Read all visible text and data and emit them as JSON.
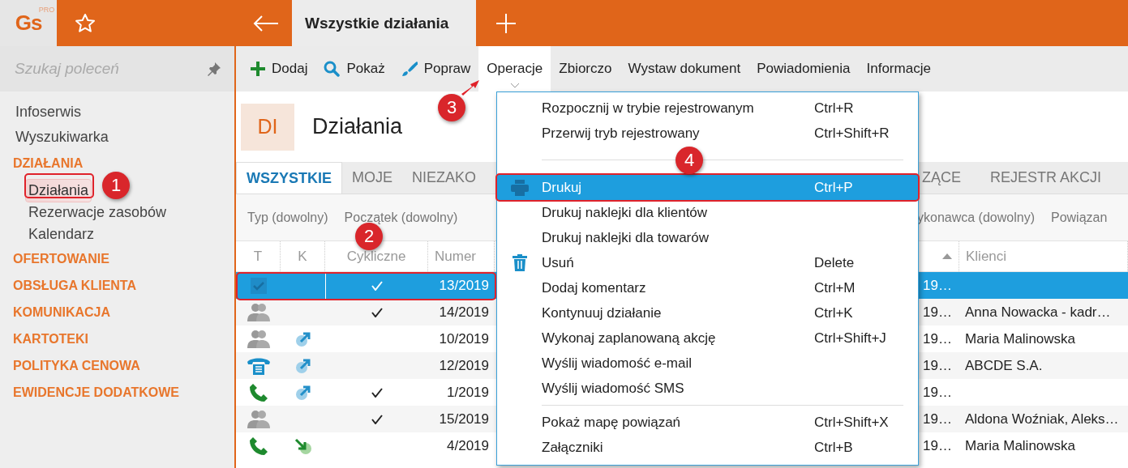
{
  "top_bar": {
    "logo": "Gs",
    "logo_badge": "PRO",
    "tab_title": "Wszystkie działania"
  },
  "sidebar": {
    "search": {
      "placeholder": "Szukaj poleceń"
    },
    "items": [
      {
        "label": "Infoserwis",
        "kind": "link",
        "selected": false
      },
      {
        "label": "Wyszukiwarka",
        "kind": "link",
        "selected": false
      },
      {
        "label": "DZIAŁANIA",
        "kind": "section",
        "children": [
          {
            "label": "Działania",
            "kind": "link",
            "selected": true
          },
          {
            "label": "Rezerwacje zasobów",
            "kind": "link",
            "selected": false
          },
          {
            "label": "Kalendarz",
            "kind": "link",
            "selected": false
          }
        ]
      },
      {
        "label": "OFERTOWANIE",
        "kind": "section"
      },
      {
        "label": "OBSŁUGA KLIENTA",
        "kind": "section"
      },
      {
        "label": "KOMUNIKACJA",
        "kind": "section"
      },
      {
        "label": "KARTOTEKI",
        "kind": "section"
      },
      {
        "label": "POLITYKA CENOWA",
        "kind": "section"
      },
      {
        "label": "EWIDENCJE DODATKOWE",
        "kind": "section"
      }
    ]
  },
  "toolbar": {
    "items": [
      {
        "label": "Dodaj",
        "kind": "add",
        "selected": false
      },
      {
        "label": "Pokaż",
        "kind": "view",
        "selected": false
      },
      {
        "label": "Popraw",
        "kind": "edit",
        "selected": false
      },
      {
        "label": "Operacje",
        "kind": "dropdown",
        "selected": true
      },
      {
        "label": "Zbiorczo",
        "kind": "text",
        "selected": false
      },
      {
        "label": "Wystaw dokument",
        "kind": "text",
        "selected": false
      },
      {
        "label": "Powiadomienia",
        "kind": "text",
        "selected": false
      },
      {
        "label": "Informacje",
        "kind": "text",
        "selected": false
      }
    ]
  },
  "page_header": {
    "code": "DI",
    "title": "Działania"
  },
  "tabs": {
    "before_menu": [
      {
        "label": "WSZYSTKIE",
        "selected": true
      },
      {
        "label": "MOJE",
        "selected": false
      },
      {
        "label": "NIEZAKO",
        "selected": false
      }
    ],
    "after_menu": [
      {
        "label": "ZĄCE",
        "selected": false
      },
      {
        "label": "REJESTR AKCJI",
        "selected": false
      }
    ]
  },
  "filters": {
    "before_menu": [
      "Typ (dowolny)",
      "Początek (dowolny)"
    ],
    "after_menu": [
      "ykonawca (dowolny)",
      "Powiązan"
    ]
  },
  "table": {
    "columns": [
      {
        "label": "T",
        "kind": "text"
      },
      {
        "label": "K",
        "kind": "text"
      },
      {
        "label": "Cykliczne",
        "kind": "text"
      },
      {
        "label": "Numer",
        "kind": "text"
      },
      {
        "kind": "sort_ascending"
      },
      {
        "label": "Klienci",
        "kind": "text"
      }
    ],
    "rows": [
      {
        "kind": "task",
        "cyclic": true,
        "number": "13/2019",
        "column_5": "19…",
        "selected": true
      },
      {
        "kind": "meeting",
        "cyclic": true,
        "number": "14/2019",
        "column_5": "19…",
        "clients": "Anna Nowacka - kadr…",
        "selected": false
      },
      {
        "kind": "meeting",
        "k_icon": {
          "kind": "outgoing"
        },
        "cyclic": false,
        "number": "10/2019",
        "column_5": "19…",
        "clients": "Maria Malinowska",
        "selected": false
      },
      {
        "kind": "desk_phone",
        "k_icon": {
          "kind": "outgoing"
        },
        "cyclic": false,
        "number": "12/2019",
        "column_5": "19…",
        "clients": "ABCDE S.A.",
        "selected": false
      },
      {
        "kind": "phone",
        "k_icon": {
          "kind": "outgoing"
        },
        "cyclic": true,
        "number": "1/2019",
        "column_5": "19…",
        "selected": false
      },
      {
        "kind": "meeting",
        "cyclic": true,
        "number": "15/2019",
        "column_5": "19…",
        "clients": "Aldona Woźniak, Aleks…",
        "selected": false
      },
      {
        "kind": "phone",
        "k_icon": {
          "kind": "incoming"
        },
        "cyclic": false,
        "number": "4/2019",
        "column_5": "19…",
        "clients": "Maria Malinowska",
        "selected": false
      }
    ]
  },
  "menu": {
    "groups": [
      [
        {
          "label": "Rozpocznij w trybie rejestrowanym",
          "shortcut": "Ctrl+R",
          "kind": "plain",
          "selected": false
        },
        {
          "label": "Przerwij tryb rejestrowany",
          "shortcut": "Ctrl+Shift+R",
          "kind": "plain",
          "selected": false
        }
      ],
      [
        {
          "label": "Drukuj",
          "shortcut": "Ctrl+P",
          "kind": "print",
          "selected": true
        },
        {
          "label": "Drukuj naklejki dla klientów",
          "kind": "plain",
          "selected": false
        },
        {
          "label": "Drukuj naklejki dla towarów",
          "kind": "plain",
          "selected": false
        },
        {
          "label": "Usuń",
          "shortcut": "Delete",
          "kind": "delete",
          "selected": false
        },
        {
          "label": "Dodaj komentarz",
          "shortcut": "Ctrl+M",
          "kind": "plain",
          "selected": false
        },
        {
          "label": "Kontynuuj działanie",
          "shortcut": "Ctrl+K",
          "kind": "plain",
          "selected": false
        },
        {
          "label": "Wykonaj zaplanowaną akcję",
          "shortcut": "Ctrl+Shift+J",
          "kind": "plain",
          "selected": false
        },
        {
          "label": "Wyślij wiadomość e-mail",
          "kind": "plain",
          "selected": false
        },
        {
          "label": "Wyślij wiadomość SMS",
          "kind": "plain",
          "selected": false
        }
      ],
      [
        {
          "label": "Pokaż mapę powiązań",
          "shortcut": "Ctrl+Shift+X",
          "kind": "plain",
          "selected": false
        },
        {
          "label": "Załączniki",
          "shortcut": "Ctrl+B",
          "kind": "plain",
          "selected": false
        }
      ]
    ]
  },
  "annotations": [
    {
      "number": "1"
    },
    {
      "number": "2"
    },
    {
      "number": "3"
    },
    {
      "number": "4"
    }
  ]
}
